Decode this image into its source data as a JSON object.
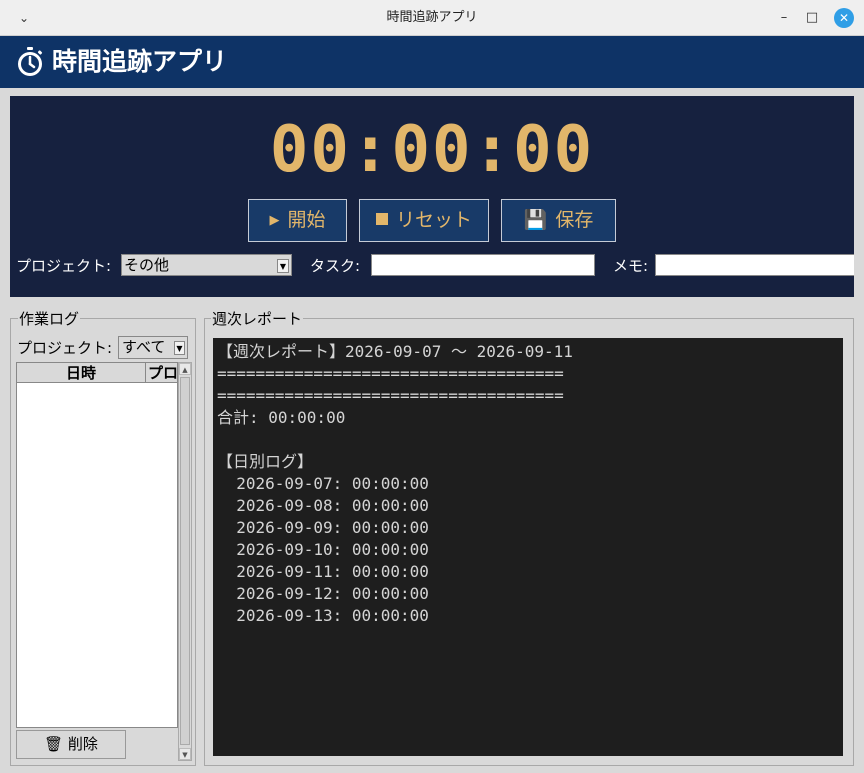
{
  "window": {
    "title": "時間追跡アプリ",
    "menu_glyph": "⌄",
    "minimize_glyph": "–",
    "maximize_glyph": "□",
    "close_glyph": "✕"
  },
  "header": {
    "title": "時間追跡アプリ",
    "icon": "stopwatch-icon"
  },
  "timer": {
    "display": "00:00:00",
    "start_label": "開始",
    "reset_label": "リセット",
    "save_label": "保存",
    "play_glyph": "▶",
    "save_glyph": "💾",
    "accent_color": "#e2b66a",
    "background_color": "#16213f"
  },
  "form": {
    "project_label": "プロジェクト:",
    "project_value": "その他",
    "task_label": "タスク:",
    "task_value": "",
    "memo_label": "メモ:",
    "memo_value": ""
  },
  "work_log": {
    "title": "作業ログ",
    "project_label": "プロジェクト:",
    "project_filter": "すべて",
    "columns": [
      "日時",
      "プロ"
    ],
    "rows": [],
    "delete_label": "削除",
    "delete_glyph": "🗑"
  },
  "weekly_report": {
    "title": "週次レポート",
    "lines": [
      "【週次レポート】2026-09-07 ～ 2026-09-11",
      "====================================",
      "====================================",
      "合計: 00:00:00",
      "",
      "【日別ログ】",
      "  2026-09-07: 00:00:00",
      "  2026-09-08: 00:00:00",
      "  2026-09-09: 00:00:00",
      "  2026-09-10: 00:00:00",
      "  2026-09-11: 00:00:00",
      "  2026-09-12: 00:00:00",
      "  2026-09-13: 00:00:00"
    ]
  }
}
